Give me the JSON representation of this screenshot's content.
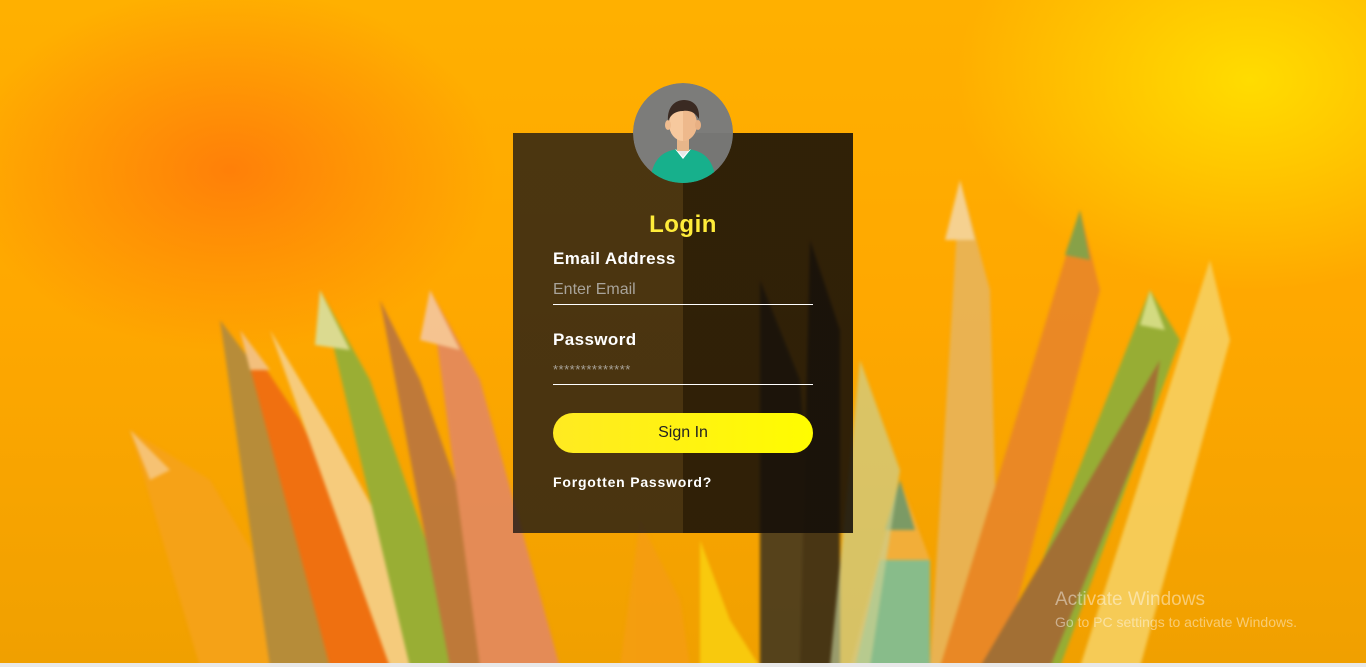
{
  "login": {
    "title": "Login",
    "email_label": "Email Address",
    "email_placeholder": "Enter Email",
    "email_value": "",
    "password_label": "Password",
    "password_placeholder": "**************",
    "password_value": "",
    "signin_label": "Sign In",
    "forgot_label": "Forgotten Password?"
  },
  "watermark": {
    "line1": "Activate Windows",
    "line2": "Go to PC settings to activate Windows."
  },
  "colors": {
    "title": "#ffec3a",
    "button": "#fffc00",
    "card": "#1e1814",
    "background": "#ffb000"
  },
  "icons": {
    "avatar": "user-avatar-icon"
  }
}
